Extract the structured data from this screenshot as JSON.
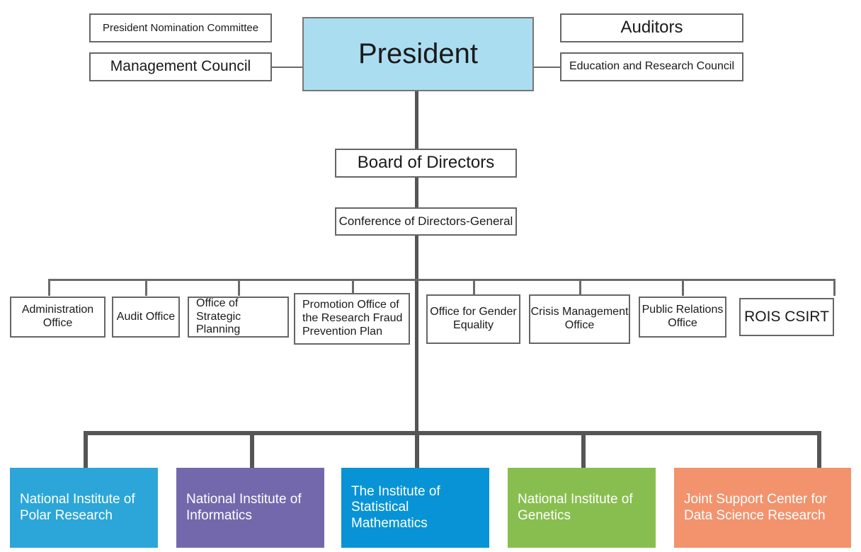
{
  "diagram": {
    "title": "Organization Chart",
    "colors": {
      "president_fill": "#abddf0",
      "box_border": "#666666",
      "connector": "#5a5a5a",
      "trunk": "#555555",
      "polar": "#2ca6d8",
      "informatics": "#7468ac",
      "statistical": "#0893d6",
      "genetics": "#88be4f",
      "joint_support": "#f2936e"
    }
  },
  "top": {
    "president": "President",
    "left_advisors": [
      {
        "label": "President Nomination Committee"
      },
      {
        "label": "Management Council"
      }
    ],
    "right_advisors": [
      {
        "label": "Auditors"
      },
      {
        "label": "Education and Research Council"
      }
    ]
  },
  "mid": {
    "board": "Board of Directors",
    "conference": "Conference of Directors-General"
  },
  "offices": [
    {
      "label": "Administration Office"
    },
    {
      "label": "Audit Office"
    },
    {
      "label": "Office of Strategic Planning"
    },
    {
      "label": "Promotion Office of the Research Fraud Prevention Plan"
    },
    {
      "label": "Office for Gender Equality"
    },
    {
      "label": "Crisis Management Office"
    },
    {
      "label": "Public Relations Office"
    },
    {
      "label": "ROIS CSIRT"
    }
  ],
  "institutes": [
    {
      "label": "National Institute of Polar Research",
      "color": "#2ca6d8"
    },
    {
      "label": "National Institute of Informatics",
      "color": "#7468ac"
    },
    {
      "label": "The Institute of Statistical Mathematics",
      "color": "#0893d6"
    },
    {
      "label": "National Institute of Genetics",
      "color": "#88be4f"
    },
    {
      "label": "Joint Support Center for Data Science Research",
      "color": "#f2936e"
    }
  ]
}
